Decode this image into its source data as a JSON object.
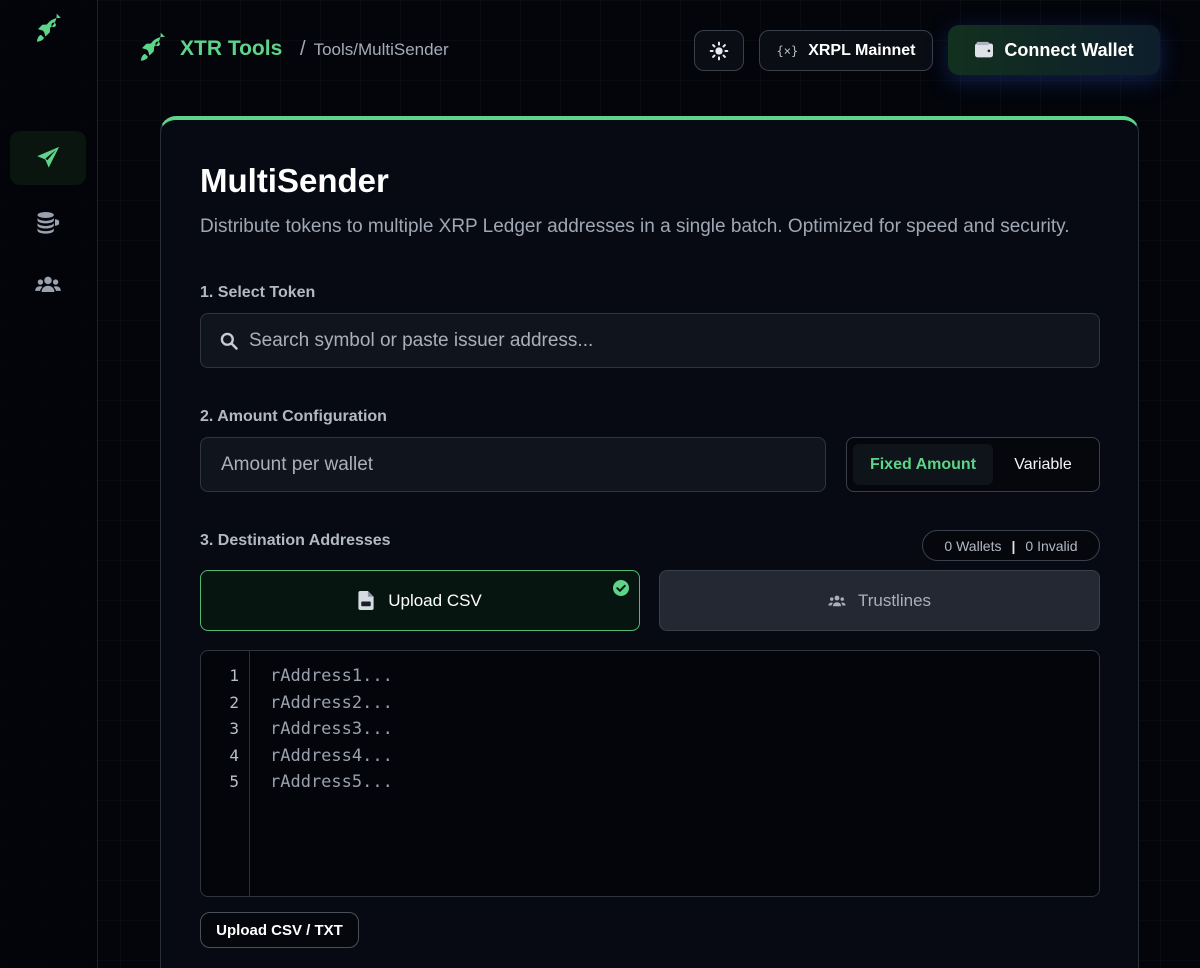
{
  "app": {
    "name": "XTR Tools",
    "breadcrumb_sep": "/",
    "breadcrumb": "Tools/MultiSender",
    "accent": "#5ed38a"
  },
  "rail": {
    "items": [
      {
        "icon": "send-icon",
        "active": true
      },
      {
        "icon": "coins-icon",
        "active": false
      },
      {
        "icon": "users-icon",
        "active": false
      }
    ]
  },
  "header": {
    "theme_icon": "sun-icon",
    "network_icon_text": "{×}",
    "network_label": "XRPL Mainnet",
    "connect_label": "Connect Wallet"
  },
  "main": {
    "title": "MultiSender",
    "subtitle": "Distribute tokens to multiple XRP Ledger addresses in a single batch. Optimized for speed and security.",
    "token": {
      "label": "1. Select Token",
      "placeholder": "Search symbol or paste issuer address...",
      "value": ""
    },
    "amount": {
      "label": "2. Amount Configuration",
      "placeholder": "Amount per wallet",
      "value": "",
      "modes": [
        "Fixed Amount",
        "Variable"
      ],
      "selected_mode": "Fixed Amount"
    },
    "destinations": {
      "label": "3. Destination Addresses",
      "wallets_count": "0 Wallets",
      "counts_sep": "|",
      "invalid_count": "0 Invalid",
      "tabs": [
        {
          "label": "Upload CSV",
          "active": true
        },
        {
          "label": "Trustlines",
          "active": false
        }
      ],
      "line_numbers": [
        "1",
        "2",
        "3",
        "4",
        "5"
      ],
      "lines": [
        "rAddress1...",
        "rAddress2...",
        "rAddress3...",
        "rAddress4...",
        "rAddress5..."
      ],
      "upload_label": "Upload CSV / TXT"
    }
  }
}
